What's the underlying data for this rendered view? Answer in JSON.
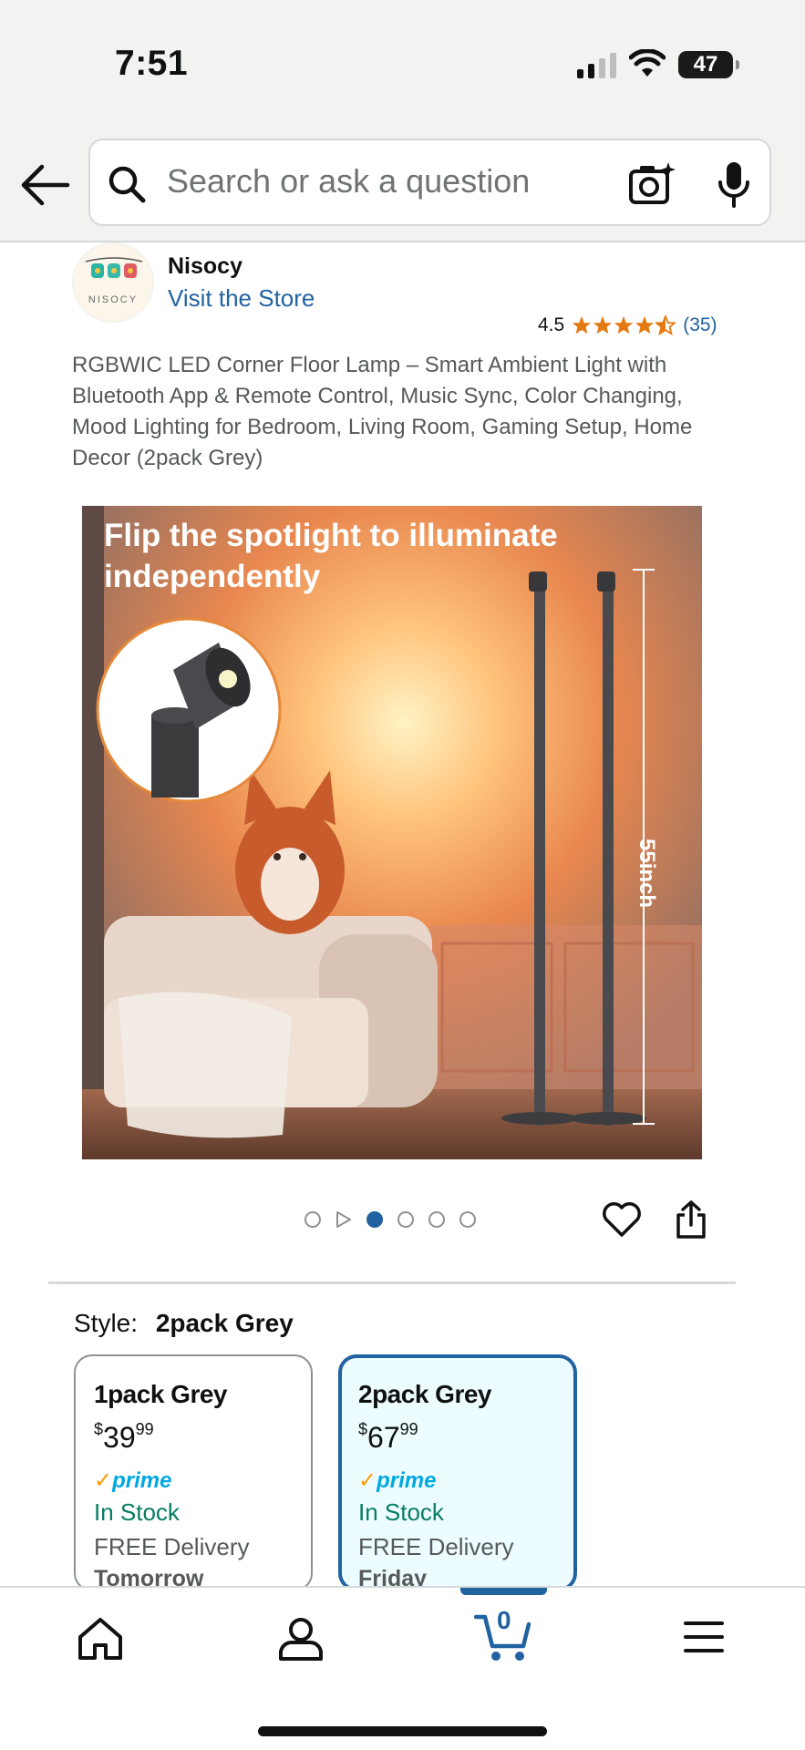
{
  "status_bar": {
    "time": "7:51",
    "battery": "47"
  },
  "search": {
    "placeholder": "Search or ask a question"
  },
  "brand": {
    "name": "Nisocy",
    "logo_text": "NISOCY",
    "visit_store": "Visit the Store"
  },
  "rating": {
    "value": "4.5",
    "stars": 4.5,
    "count": "(35)"
  },
  "product": {
    "title": "RGBWIC LED Corner Floor Lamp – Smart Ambient Light with Bluetooth App & Remote Control, Music Sync, Color Changing, Mood Lighting for Bedroom, Living Room, Gaming Setup, Home Decor (2pack Grey)"
  },
  "image": {
    "caption": "Flip the spotlight to illuminate independently",
    "height_label": "55inch",
    "current_index": 1,
    "total_images": 4
  },
  "style": {
    "label": "Style:",
    "selected": "2pack Grey",
    "options": [
      {
        "name": "1pack Grey",
        "currency": "$",
        "whole": "39",
        "fraction": "99",
        "prime": "prime",
        "stock": "In Stock",
        "delivery": "FREE Delivery",
        "day": "Tomorrow"
      },
      {
        "name": "2pack Grey",
        "currency": "$",
        "whole": "67",
        "fraction": "99",
        "prime": "prime",
        "stock": "In Stock",
        "delivery": "FREE Delivery",
        "day": "Friday"
      }
    ]
  },
  "nav": {
    "cart_count": "0"
  },
  "colors": {
    "link": "#2162a1",
    "star": "#e47911",
    "stock": "#067d62",
    "prime": "#00a8e1",
    "selected_bg": "#edfdff"
  }
}
